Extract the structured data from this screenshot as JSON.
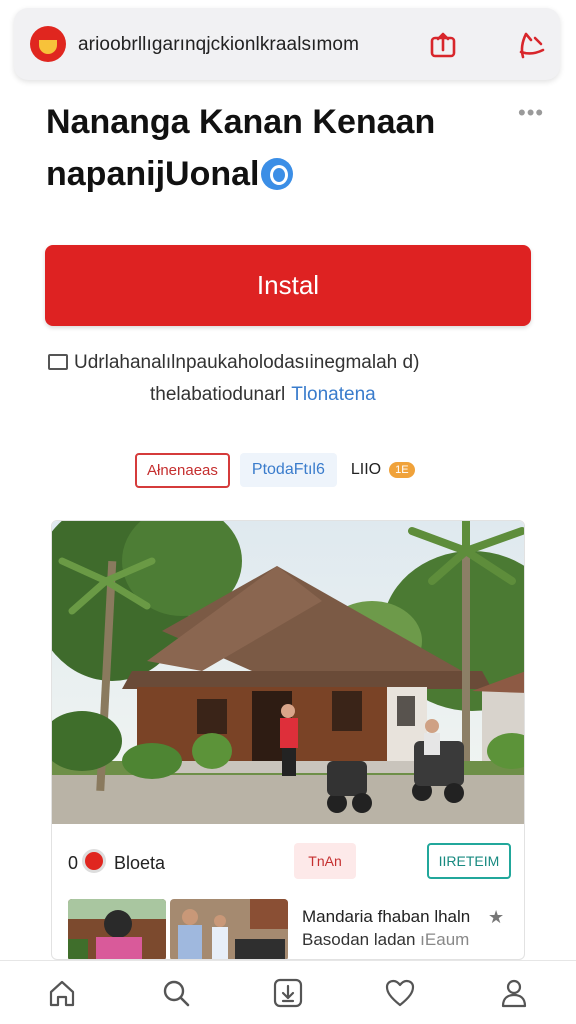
{
  "browser": {
    "url": "arioobrllıgarınqjckionlkraalsımom",
    "colors": {
      "brand": "#e0261f",
      "accent": "#3b8ee6"
    }
  },
  "app": {
    "title_line1": "Nananga Kanan Kenaan",
    "title_line2": "napanijUonal",
    "install_label": "Instal",
    "desc_line1": "Udrlahanalılnpaukaholodasıinegmalah d)",
    "desc_line2": "thelabatiodunarl",
    "desc_link": "Tlonatena",
    "tags": {
      "tag1": "Ałnenaeas",
      "tag2": "PtodaFtıl6",
      "tag3": "LIIO",
      "badge": "1E"
    }
  },
  "card": {
    "photo_icon": "traditional-house-photo",
    "stat_number": "0",
    "stat_label": "Bloeta",
    "button1": "TnAn",
    "button2": "IIRETEIM",
    "item_line1": "Mandaria fhaban lhaln",
    "item_line2a": "Basodan ladan",
    "item_line2b": "ıEaum"
  },
  "bottom_nav": {
    "items": [
      "home-icon",
      "search-icon",
      "download-icon",
      "heart-icon",
      "profile-icon"
    ]
  }
}
